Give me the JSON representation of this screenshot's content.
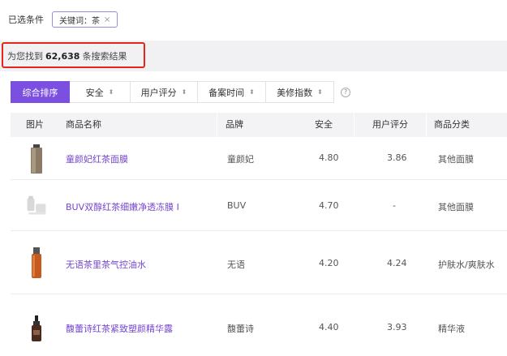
{
  "filters": {
    "label": "已选条件",
    "chip_label": "关键词：茶",
    "chip_close": "×"
  },
  "result": {
    "prefix": "为您找到",
    "count": "62,638",
    "suffix": "条搜索结果"
  },
  "sort": {
    "tabs": [
      {
        "label": "综合排序"
      },
      {
        "label": "安全"
      },
      {
        "label": "用户评分"
      },
      {
        "label": "备案时间"
      },
      {
        "label": "美修指数"
      }
    ],
    "help_icon": "question-circle-icon"
  },
  "table": {
    "headers": [
      "图片",
      "商品名称",
      "品牌",
      "安全",
      "用户评分",
      "商品分类"
    ],
    "rows": [
      {
        "name": "童颜妃红茶面膜",
        "brand": "童颜妃",
        "safety": "4.80",
        "rating": "3.86",
        "category": "其他面膜",
        "thumb": "tube-icon"
      },
      {
        "name": "BUV双醇红茶细嫩净透冻膜 I",
        "brand": "BUV",
        "safety": "4.70",
        "rating": "-",
        "category": "其他面膜",
        "thumb": "placeholder-image-icon"
      },
      {
        "name": "无语茶里茶气控油水",
        "brand": "无语",
        "safety": "4.20",
        "rating": "4.24",
        "category": "护肤水/爽肤水",
        "thumb": "bottle-icon"
      },
      {
        "name": "馥蕾诗红茶紧致塑颜精华露",
        "brand": "馥蕾诗",
        "safety": "4.40",
        "rating": "3.93",
        "category": "精华液",
        "thumb": "dropper-bottle-icon"
      }
    ]
  },
  "colors": {
    "accent": "#7b4fe0",
    "link": "#7447cf",
    "highlight": "#e5261d"
  }
}
